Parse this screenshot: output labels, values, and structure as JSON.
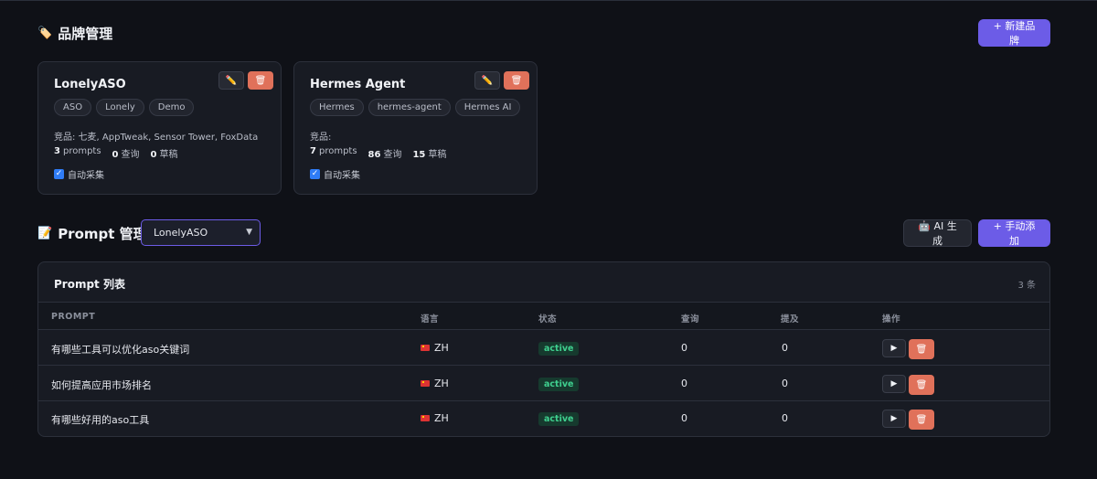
{
  "brand_section": {
    "emoji": "🏷️",
    "title": "品牌管理",
    "new_button": "+ 新建品牌",
    "brands": [
      {
        "name": "LonelyASO",
        "tags": [
          "ASO",
          "Lonely",
          "Demo"
        ],
        "competitors": "竞品: 七麦, AppTweak, Sensor Tower, FoxData",
        "prompts_count": "3",
        "prompts_label": "prompts",
        "queries_count": "0",
        "queries_label": "查询",
        "drafts_count": "0",
        "drafts_label": "草稿",
        "auto_label": "自动采集"
      },
      {
        "name": "Hermes Agent",
        "tags": [
          "Hermes",
          "hermes-agent",
          "Hermes AI"
        ],
        "competitors": "竞品:",
        "prompts_count": "7",
        "prompts_label": "prompts",
        "queries_count": "86",
        "queries_label": "查询",
        "drafts_count": "15",
        "drafts_label": "草稿",
        "auto_label": "自动采集"
      }
    ],
    "edit_icon": "✏️",
    "delete_icon": "🗑"
  },
  "prompt_section": {
    "emoji": "📝",
    "title": "Prompt 管理",
    "selected_brand": "LonelyASO",
    "ai_button": "🤖 AI 生成",
    "manual_button": "+ 手动添加",
    "panel_title": "Prompt 列表",
    "panel_count": "3 条",
    "columns": [
      "PROMPT",
      "语言",
      "状态",
      "查询",
      "提及",
      "操作"
    ],
    "rows": [
      {
        "prompt": "有哪些工具可以优化aso关键词",
        "lang": "ZH",
        "status": "active",
        "queries": "0",
        "mentions": "0"
      },
      {
        "prompt": "如何提高应用市场排名",
        "lang": "ZH",
        "status": "active",
        "queries": "0",
        "mentions": "0"
      },
      {
        "prompt": "有哪些好用的aso工具",
        "lang": "ZH",
        "status": "active",
        "queries": "0",
        "mentions": "0"
      }
    ],
    "play_icon": "▶",
    "delete_icon": "🗑"
  },
  "colors": {
    "background": "#0f1117",
    "card": "#181b23",
    "accent": "#6c5ce7",
    "danger": "#e0715a",
    "status_active": "#3fd08f"
  }
}
